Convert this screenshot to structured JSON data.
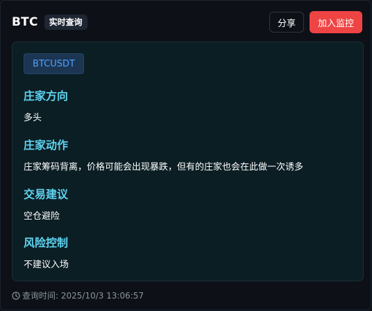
{
  "header": {
    "symbol": "BTC",
    "badge": "实时查询",
    "share_label": "分享",
    "monitor_label": "加入监控"
  },
  "card": {
    "pair": "BTCUSDT",
    "sections": [
      {
        "title": "庄家方向",
        "body": "多头"
      },
      {
        "title": "庄家动作",
        "body": "庄家筹码背离，价格可能会出现暴跌，但有的庄家也会在此做一次诱多"
      },
      {
        "title": "交易建议",
        "body": "空仓避险"
      },
      {
        "title": "风险控制",
        "body": "不建议入场"
      }
    ]
  },
  "footer": {
    "query_time": "查询时间: 2025/10/3 13:06:57",
    "icon": "clock-icon"
  },
  "colors": {
    "accent_title": "#5fd3f0",
    "danger_button": "#ef4444",
    "pair_tag_text": "#4ea1ff",
    "background": "#0d1117",
    "card_background": "#0b1e24"
  }
}
